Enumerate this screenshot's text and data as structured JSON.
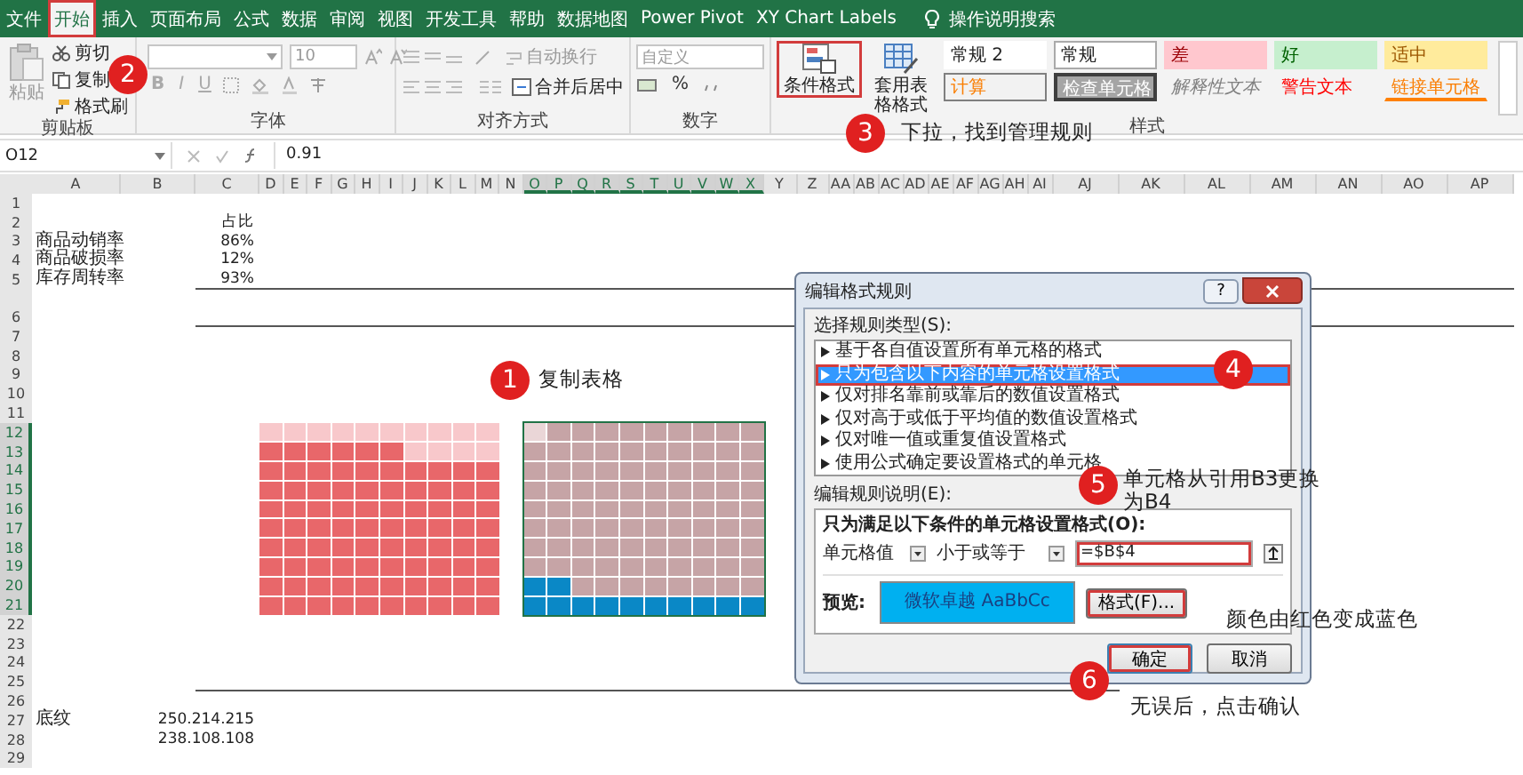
{
  "ribbon_tabs": [
    {
      "label": "文件",
      "selected": false
    },
    {
      "label": "开始",
      "selected": true
    },
    {
      "label": "插入",
      "selected": false
    },
    {
      "label": "页面布局",
      "selected": false
    },
    {
      "label": "公式",
      "selected": false
    },
    {
      "label": "数据",
      "selected": false
    },
    {
      "label": "审阅",
      "selected": false
    },
    {
      "label": "视图",
      "selected": false
    },
    {
      "label": "开发工具",
      "selected": false
    },
    {
      "label": "帮助",
      "selected": false
    },
    {
      "label": "数据地图",
      "selected": false
    },
    {
      "label": "Power Pivot",
      "selected": false
    },
    {
      "label": "XY Chart Labels",
      "selected": false
    }
  ],
  "search": {
    "placeholder": "操作说明搜索"
  },
  "clipboard": {
    "paste": "粘贴",
    "cut": "剪切",
    "copy": "复制",
    "format_painter": "格式刷",
    "label": "剪贴板"
  },
  "font": {
    "size": "10",
    "bold": "B",
    "italic": "I",
    "underline": "U",
    "label": "字体"
  },
  "alignment": {
    "wrap_text": "自动换行",
    "merge_center": "合并后居中",
    "label": "对齐方式"
  },
  "number": {
    "format": "自定义",
    "percent": "%",
    "label": "数字"
  },
  "styles": {
    "conditional_formatting": "条件格式",
    "format_as_table": "套用表格格式",
    "label": "样式",
    "gallery": [
      {
        "label": "常规 2",
        "kind": "plain"
      },
      {
        "label": "常规",
        "kind": "normal"
      },
      {
        "label": "差",
        "kind": "bad"
      },
      {
        "label": "好",
        "kind": "good"
      },
      {
        "label": "适中",
        "kind": "neutral"
      },
      {
        "label": "计算",
        "kind": "calculation"
      },
      {
        "label": "检查单元格",
        "kind": "check"
      },
      {
        "label": "解释性文本",
        "kind": "explanatory"
      },
      {
        "label": "警告文本",
        "kind": "warning"
      },
      {
        "label": "链接单元格",
        "kind": "linked"
      }
    ]
  },
  "formula_bar": {
    "name_box": "O12",
    "formula": "0.91"
  },
  "columns": [
    {
      "label": "A",
      "selected": false
    },
    {
      "label": "B",
      "selected": false
    },
    {
      "label": "C",
      "selected": false
    },
    {
      "label": "D",
      "selected": false
    },
    {
      "label": "E",
      "selected": false
    },
    {
      "label": "F",
      "selected": false
    },
    {
      "label": "G",
      "selected": false
    },
    {
      "label": "H",
      "selected": false
    },
    {
      "label": "I",
      "selected": false
    },
    {
      "label": "J",
      "selected": false
    },
    {
      "label": "K",
      "selected": false
    },
    {
      "label": "L",
      "selected": false
    },
    {
      "label": "M",
      "selected": false
    },
    {
      "label": "N",
      "selected": false
    },
    {
      "label": "O",
      "selected": true
    },
    {
      "label": "P",
      "selected": true
    },
    {
      "label": "Q",
      "selected": true
    },
    {
      "label": "R",
      "selected": true
    },
    {
      "label": "S",
      "selected": true
    },
    {
      "label": "T",
      "selected": true
    },
    {
      "label": "U",
      "selected": true
    },
    {
      "label": "V",
      "selected": true
    },
    {
      "label": "W",
      "selected": true
    },
    {
      "label": "X",
      "selected": true
    },
    {
      "label": "Y",
      "selected": false
    },
    {
      "label": "Z",
      "selected": false
    },
    {
      "label": "AA",
      "selected": false
    },
    {
      "label": "AB",
      "selected": false
    },
    {
      "label": "AC",
      "selected": false
    },
    {
      "label": "AD",
      "selected": false
    },
    {
      "label": "AE",
      "selected": false
    },
    {
      "label": "AF",
      "selected": false
    },
    {
      "label": "AG",
      "selected": false
    },
    {
      "label": "AH",
      "selected": false
    },
    {
      "label": "AI",
      "selected": false
    },
    {
      "label": "AJ",
      "selected": false
    },
    {
      "label": "AK",
      "selected": false
    },
    {
      "label": "AL",
      "selected": false
    },
    {
      "label": "AM",
      "selected": false
    },
    {
      "label": "AN",
      "selected": false
    },
    {
      "label": "AO",
      "selected": false
    },
    {
      "label": "AP",
      "selected": false
    }
  ],
  "rows": [
    {
      "label": "1",
      "selected": false
    },
    {
      "label": "2",
      "selected": false,
      "col_b": "占比"
    },
    {
      "label": "3",
      "selected": false,
      "col_a": "商品动销率",
      "col_b": "86%"
    },
    {
      "label": "4",
      "selected": false,
      "col_a": "商品破损率",
      "col_b": "12%"
    },
    {
      "label": "5",
      "selected": false,
      "col_a": "库存周转率",
      "col_b": "93%"
    },
    {
      "label": "6",
      "selected": false
    },
    {
      "label": "7",
      "selected": false
    },
    {
      "label": "8",
      "selected": false
    },
    {
      "label": "9",
      "selected": false
    },
    {
      "label": "10",
      "selected": false
    },
    {
      "label": "11",
      "selected": false
    },
    {
      "label": "12",
      "selected": true
    },
    {
      "label": "13",
      "selected": true
    },
    {
      "label": "14",
      "selected": true
    },
    {
      "label": "15",
      "selected": true
    },
    {
      "label": "16",
      "selected": true
    },
    {
      "label": "17",
      "selected": true
    },
    {
      "label": "18",
      "selected": true
    },
    {
      "label": "19",
      "selected": true
    },
    {
      "label": "20",
      "selected": true
    },
    {
      "label": "21",
      "selected": true
    },
    {
      "label": "22",
      "selected": false
    },
    {
      "label": "23",
      "selected": false
    },
    {
      "label": "24",
      "selected": false
    },
    {
      "label": "25",
      "selected": false
    },
    {
      "label": "26",
      "selected": false
    },
    {
      "label": "27",
      "selected": false,
      "col_a": "底纹",
      "col_b": "250.214.215"
    },
    {
      "label": "28",
      "selected": false,
      "col_b": "238.108.108"
    },
    {
      "label": "29",
      "selected": false
    }
  ],
  "waffles": [
    {
      "kind": "red",
      "level": 0.86
    },
    {
      "kind": "blue",
      "level": 0.12
    }
  ],
  "dialog": {
    "title": "编辑格式规则",
    "help": "?",
    "rule_type_label": "选择规则类型(S):",
    "rule_types": [
      {
        "label": "基于各自值设置所有单元格的格式",
        "selected": false
      },
      {
        "label": "只为包含以下内容的单元格设置格式",
        "selected": true
      },
      {
        "label": "仅对排名靠前或靠后的数值设置格式",
        "selected": false
      },
      {
        "label": "仅对高于或低于平均值的数值设置格式",
        "selected": false
      },
      {
        "label": "仅对唯一值或重复值设置格式",
        "selected": false
      },
      {
        "label": "使用公式确定要设置格式的单元格",
        "selected": false
      }
    ],
    "description_label": "编辑规则说明(E):",
    "condition_label": "只为满足以下条件的单元格设置格式(O):",
    "condition_field": "单元格值",
    "operator": "小于或等于",
    "value": "=$B$4",
    "preview_label": "预览:",
    "preview_text": "微软卓越  AaBbCc",
    "format_button": "格式(F)...",
    "ok": "确定",
    "cancel": "取消"
  },
  "annotations": [
    {
      "number": "1",
      "text": "复制表格"
    },
    {
      "number": "2"
    },
    {
      "number": "3",
      "text": "下拉，找到管理规则"
    },
    {
      "number": "4"
    },
    {
      "number": "5",
      "text": "单元格从引用B3更换为B4"
    },
    {
      "number": "6",
      "text": "无误后，点击确认"
    },
    {
      "text": "颜色由红色变成蓝色"
    }
  ]
}
